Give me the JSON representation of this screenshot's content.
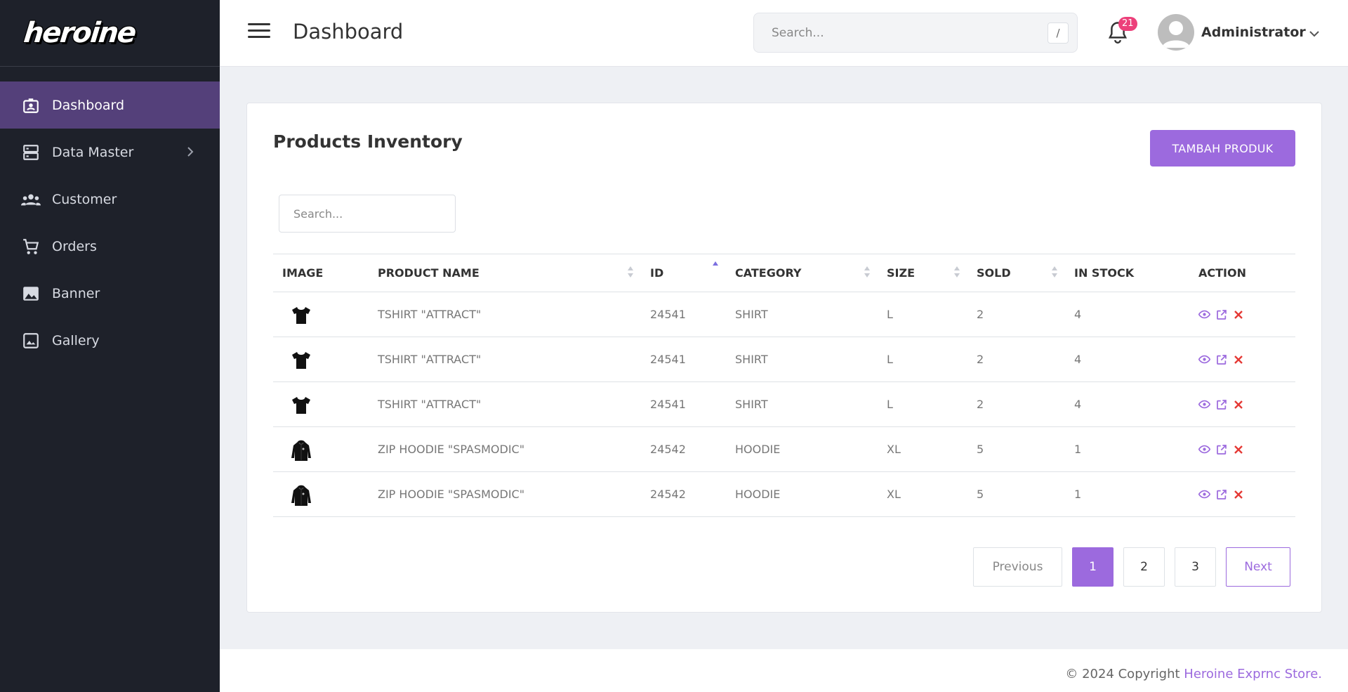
{
  "app": {
    "logo_text": "heroine",
    "page_title": "Dashboard"
  },
  "sidebar": {
    "items": [
      {
        "label": "Dashboard",
        "icon": "dashboard-icon",
        "active": true
      },
      {
        "label": "Data Master",
        "icon": "server-icon",
        "has_submenu": true
      },
      {
        "label": "Customer",
        "icon": "users-icon"
      },
      {
        "label": "Orders",
        "icon": "cart-icon"
      },
      {
        "label": "Banner",
        "icon": "image-icon"
      },
      {
        "label": "Gallery",
        "icon": "gallery-icon"
      }
    ]
  },
  "topbar": {
    "search_placeholder": "Search...",
    "search_shortcut": "/",
    "notification_count": "21",
    "user_name": "Administrator"
  },
  "card": {
    "title": "Products Inventory",
    "add_button": "TAMBAH PRODUK",
    "search_placeholder": "Search..."
  },
  "table": {
    "columns": [
      "IMAGE",
      "PRODUCT NAME",
      "ID",
      "CATEGORY",
      "SIZE",
      "SOLD",
      "IN STOCK",
      "ACTION"
    ],
    "rows": [
      {
        "image": "tshirt-icon",
        "name": "TSHIRT \"ATTRACT\"",
        "id": "24541",
        "category": "SHIRT",
        "size": "L",
        "sold": "2",
        "stock": "4"
      },
      {
        "image": "tshirt-icon",
        "name": "TSHIRT \"ATTRACT\"",
        "id": "24541",
        "category": "SHIRT",
        "size": "L",
        "sold": "2",
        "stock": "4"
      },
      {
        "image": "tshirt-icon",
        "name": "TSHIRT \"ATTRACT\"",
        "id": "24541",
        "category": "SHIRT",
        "size": "L",
        "sold": "2",
        "stock": "4"
      },
      {
        "image": "hoodie-icon",
        "name": "ZIP HOODIE \"SPASMODIC\"",
        "id": "24542",
        "category": "HOODIE",
        "size": "XL",
        "sold": "5",
        "stock": "1"
      },
      {
        "image": "hoodie-icon",
        "name": "ZIP HOODIE \"SPASMODIC\"",
        "id": "24542",
        "category": "HOODIE",
        "size": "XL",
        "sold": "5",
        "stock": "1"
      }
    ]
  },
  "pagination": {
    "previous": "Previous",
    "pages": [
      "1",
      "2",
      "3"
    ],
    "current": "1",
    "next": "Next"
  },
  "footer": {
    "prefix": "© 2024 Copyright ",
    "brand": "Heroine Exprnc Store."
  },
  "colors": {
    "accent": "#9c6ade",
    "sidebar_bg": "#1e212a",
    "sidebar_active": "#54407a",
    "danger": "#e53935",
    "badge": "#ec407a"
  }
}
